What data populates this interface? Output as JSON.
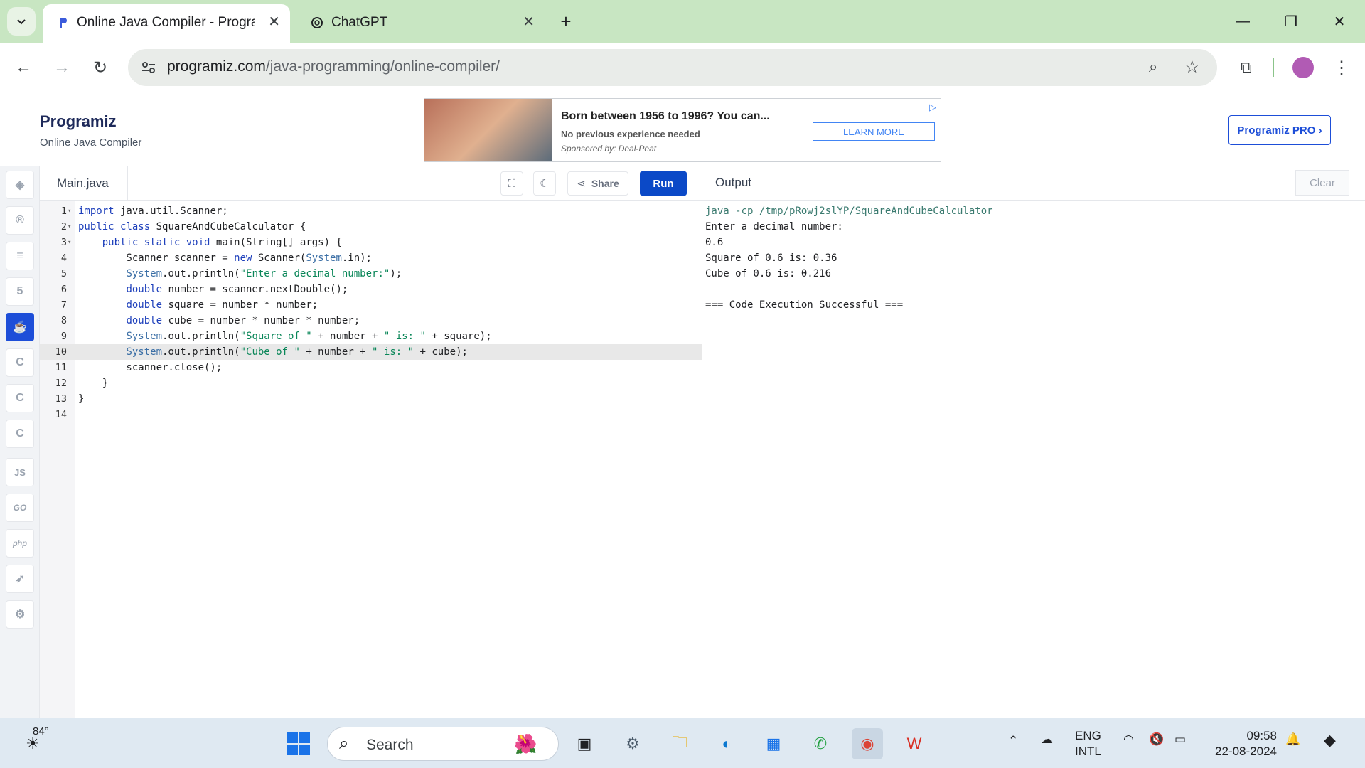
{
  "browser": {
    "tabs": [
      {
        "title": "Online Java Compiler - Program",
        "active": true
      },
      {
        "title": "ChatGPT",
        "active": false
      }
    ],
    "url_host": "programiz.com",
    "url_path": "/java-programming/online-compiler/"
  },
  "site": {
    "logo": "Programiz",
    "subtitle": "Online Java Compiler",
    "pro_button": "Programiz PRO ›"
  },
  "ad": {
    "title": "Born between 1956 to 1996? You can...",
    "subtitle": "No previous experience needed",
    "sponsor": "Sponsored by: Deal-Peat",
    "cta": "LEARN MORE"
  },
  "leftnav": {
    "items": [
      "python",
      "r",
      "sql",
      "html",
      "java",
      "c",
      "cpp",
      "csharp",
      "JS",
      "GO",
      "php",
      "swift",
      "rust"
    ],
    "active": "java"
  },
  "editor": {
    "filename": "Main.java",
    "share_label": "Share",
    "run_label": "Run",
    "highlighted_line": 10,
    "lines": [
      {
        "n": "1",
        "fold": true,
        "text": "import java.util.Scanner;"
      },
      {
        "n": "2",
        "fold": true,
        "text": "public class SquareAndCubeCalculator {"
      },
      {
        "n": "3",
        "fold": true,
        "text": "    public static void main(String[] args) {"
      },
      {
        "n": "4",
        "fold": false,
        "text": "        Scanner scanner = new Scanner(System.in);"
      },
      {
        "n": "5",
        "fold": false,
        "text": "        System.out.println(\"Enter a decimal number:\");"
      },
      {
        "n": "6",
        "fold": false,
        "text": "        double number = scanner.nextDouble();"
      },
      {
        "n": "7",
        "fold": false,
        "text": "        double square = number * number;"
      },
      {
        "n": "8",
        "fold": false,
        "text": "        double cube = number * number * number;"
      },
      {
        "n": "9",
        "fold": false,
        "text": "        System.out.println(\"Square of \" + number + \" is: \" + square);"
      },
      {
        "n": "10",
        "fold": false,
        "text": "        System.out.println(\"Cube of \" + number + \" is: \" + cube);"
      },
      {
        "n": "11",
        "fold": false,
        "text": "        scanner.close();"
      },
      {
        "n": "12",
        "fold": false,
        "text": "    }"
      },
      {
        "n": "13",
        "fold": false,
        "text": "}"
      },
      {
        "n": "14",
        "fold": false,
        "text": ""
      }
    ]
  },
  "output": {
    "title": "Output",
    "clear_label": "Clear",
    "lines": [
      {
        "text": "java -cp /tmp/pRowj2slYP/SquareAndCubeCalculator",
        "kind": "cmd"
      },
      {
        "text": "Enter a decimal number:",
        "kind": "out"
      },
      {
        "text": "0.6",
        "kind": "out"
      },
      {
        "text": "Square of 0.6 is: 0.36",
        "kind": "out"
      },
      {
        "text": "Cube of 0.6 is: 0.216",
        "kind": "out"
      },
      {
        "text": "",
        "kind": "out"
      },
      {
        "text": "=== Code Execution Successful ===",
        "kind": "out"
      }
    ]
  },
  "taskbar": {
    "weather": "84°",
    "search_placeholder": "Search",
    "lang": "ENG",
    "lang_layout": "INTL",
    "time": "09:58",
    "date": "22-08-2024"
  },
  "colors": {
    "accent": "#0b49c7",
    "tabstrip": "#c8e6c2",
    "keyword": "#1d3fbb",
    "string": "#098658",
    "command": "#3a7a6f"
  }
}
